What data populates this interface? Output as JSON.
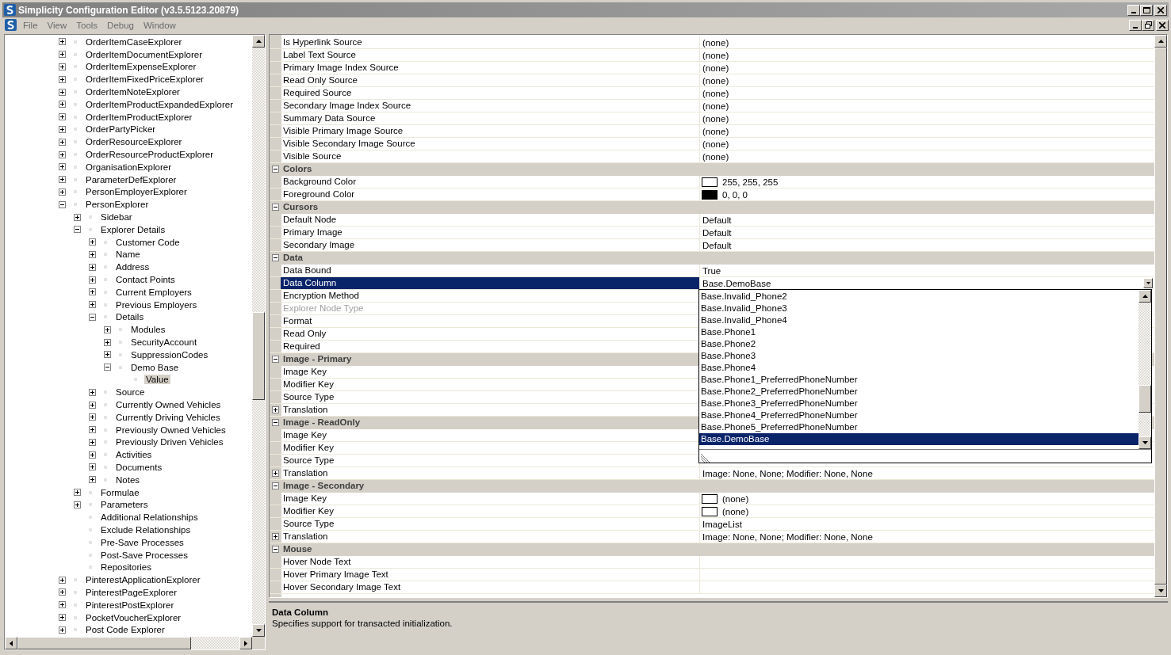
{
  "window": {
    "title": "Simplicity Configuration Editor (v3.5.5123.20879)"
  },
  "menu": [
    {
      "label": "File"
    },
    {
      "label": "View"
    },
    {
      "label": "Tools"
    },
    {
      "label": "Debug"
    },
    {
      "label": "Window"
    }
  ],
  "tree": {
    "nodes": [
      {
        "label": "OrderItemCaseExplorer",
        "kind": "folder",
        "expanded": false,
        "selected": false
      },
      {
        "label": "OrderItemDocumentExplorer",
        "kind": "folder",
        "expanded": false,
        "selected": false
      },
      {
        "label": "OrderItemExpenseExplorer",
        "kind": "folder",
        "expanded": false,
        "selected": false
      },
      {
        "label": "OrderItemFixedPriceExplorer",
        "kind": "folder",
        "expanded": false,
        "selected": false
      },
      {
        "label": "OrderItemNoteExplorer",
        "kind": "folder",
        "expanded": false,
        "selected": false
      },
      {
        "label": "OrderItemProductExpandedExplorer",
        "kind": "folder",
        "expanded": false,
        "selected": false
      },
      {
        "label": "OrderItemProductExplorer",
        "kind": "folder",
        "expanded": false,
        "selected": false
      },
      {
        "label": "OrderPartyPicker",
        "kind": "folder",
        "expanded": false,
        "selected": false
      },
      {
        "label": "OrderResourceExplorer",
        "kind": "folder",
        "expanded": false,
        "selected": false
      },
      {
        "label": "OrderResourceProductExplorer",
        "kind": "folder",
        "expanded": false,
        "selected": false
      },
      {
        "label": "OrganisationExplorer",
        "kind": "folder",
        "expanded": false,
        "selected": false
      },
      {
        "label": "ParameterDefExplorer",
        "kind": "folder",
        "expanded": false,
        "selected": false
      },
      {
        "label": "PersonEmployerExplorer",
        "kind": "folder",
        "expanded": false,
        "selected": false
      },
      {
        "label": "PersonExplorer",
        "kind": "folder",
        "expanded": true,
        "selected": false,
        "children": [
          {
            "label": "Sidebar",
            "kind": "folder",
            "expanded": false,
            "selected": false
          },
          {
            "label": "Explorer Details",
            "kind": "folder",
            "expanded": true,
            "selected": false,
            "children": [
              {
                "label": "Customer Code",
                "kind": "folder",
                "expanded": false,
                "selected": false
              },
              {
                "label": "Name",
                "kind": "folder",
                "expanded": false,
                "selected": false
              },
              {
                "label": "Address",
                "kind": "folder",
                "expanded": false,
                "selected": false
              },
              {
                "label": "Contact Points",
                "kind": "folder",
                "expanded": false,
                "selected": false
              },
              {
                "label": "Current Employers",
                "kind": "folder",
                "expanded": false,
                "selected": false
              },
              {
                "label": "Previous Employers",
                "kind": "folder",
                "expanded": false,
                "selected": false
              },
              {
                "label": "Details",
                "kind": "folder",
                "expanded": true,
                "selected": false,
                "children": [
                  {
                    "label": "Modules",
                    "kind": "folder",
                    "expanded": false,
                    "selected": false
                  },
                  {
                    "label": "SecurityAccount",
                    "kind": "folder",
                    "expanded": false,
                    "selected": false
                  },
                  {
                    "label": "SuppressionCodes",
                    "kind": "folder",
                    "expanded": false,
                    "selected": false
                  },
                  {
                    "label": "Demo Base",
                    "kind": "folder",
                    "expanded": true,
                    "selected": false,
                    "children": [
                      {
                        "label": "Value",
                        "kind": "leaf",
                        "selected": true
                      }
                    ]
                  }
                ]
              },
              {
                "label": "Source",
                "kind": "folder",
                "expanded": false,
                "selected": false
              },
              {
                "label": "Currently Owned Vehicles",
                "kind": "folder",
                "expanded": false,
                "selected": false
              },
              {
                "label": "Currently Driving Vehicles",
                "kind": "folder",
                "expanded": false,
                "selected": false
              },
              {
                "label": "Previously Owned Vehicles",
                "kind": "folder",
                "expanded": false,
                "selected": false
              },
              {
                "label": "Previously Driven Vehicles",
                "kind": "folder",
                "expanded": false,
                "selected": false
              },
              {
                "label": "Activities",
                "kind": "folder",
                "expanded": false,
                "selected": false
              },
              {
                "label": "Documents",
                "kind": "folder",
                "expanded": false,
                "selected": false
              },
              {
                "label": "Notes",
                "kind": "folder",
                "expanded": false,
                "selected": false
              }
            ]
          },
          {
            "label": "Formulae",
            "kind": "folder",
            "expanded": false,
            "selected": false
          },
          {
            "label": "Parameters",
            "kind": "folder",
            "expanded": false,
            "selected": false
          },
          {
            "label": "Additional Relationships",
            "kind": "leaf",
            "selected": false
          },
          {
            "label": "Exclude Relationships",
            "kind": "leaf",
            "selected": false
          },
          {
            "label": "Pre-Save Processes",
            "kind": "leaf",
            "selected": false
          },
          {
            "label": "Post-Save Processes",
            "kind": "leaf",
            "selected": false
          },
          {
            "label": "Repositories",
            "kind": "leaf",
            "selected": false
          }
        ]
      },
      {
        "label": "PinterestApplicationExplorer",
        "kind": "folder",
        "expanded": false,
        "selected": false
      },
      {
        "label": "PinterestPageExplorer",
        "kind": "folder",
        "expanded": false,
        "selected": false
      },
      {
        "label": "PinterestPostExplorer",
        "kind": "folder",
        "expanded": false,
        "selected": false
      },
      {
        "label": "PocketVoucherExplorer",
        "kind": "folder",
        "expanded": false,
        "selected": false
      },
      {
        "label": "Post Code Explorer",
        "kind": "folder",
        "expanded": false,
        "selected": false
      }
    ]
  },
  "property_grid": {
    "rows": [
      {
        "kind": "property",
        "name": "Is Hyperlink Source",
        "value": "(none)",
        "selected": false,
        "disabled": false
      },
      {
        "kind": "property",
        "name": "Label Text Source",
        "value": "(none)",
        "selected": false,
        "disabled": false
      },
      {
        "kind": "property",
        "name": "Primary Image Index Source",
        "value": "(none)",
        "selected": false,
        "disabled": false
      },
      {
        "kind": "property",
        "name": "Read Only Source",
        "value": "(none)",
        "selected": false,
        "disabled": false
      },
      {
        "kind": "property",
        "name": "Required Source",
        "value": "(none)",
        "selected": false,
        "disabled": false
      },
      {
        "kind": "property",
        "name": "Secondary Image Index Source",
        "value": "(none)",
        "selected": false,
        "disabled": false
      },
      {
        "kind": "property",
        "name": "Summary Data Source",
        "value": "(none)",
        "selected": false,
        "disabled": false
      },
      {
        "kind": "property",
        "name": "Visible Primary Image Source",
        "value": "(none)",
        "selected": false,
        "disabled": false
      },
      {
        "kind": "property",
        "name": "Visible Secondary Image Source",
        "value": "(none)",
        "selected": false,
        "disabled": false
      },
      {
        "kind": "property",
        "name": "Visible Source",
        "value": "(none)",
        "selected": false,
        "disabled": false
      },
      {
        "kind": "category",
        "name": "Colors",
        "expanded": true
      },
      {
        "kind": "property",
        "name": "Background Color",
        "value": "255, 255, 255",
        "color": "#ffffff",
        "selected": false,
        "disabled": false
      },
      {
        "kind": "property",
        "name": "Foreground Color",
        "value": "0, 0, 0",
        "color": "#000000",
        "selected": false,
        "disabled": false
      },
      {
        "kind": "category",
        "name": "Cursors",
        "expanded": true
      },
      {
        "kind": "property",
        "name": "Default Node",
        "value": "Default",
        "selected": false,
        "disabled": false
      },
      {
        "kind": "property",
        "name": "Primary Image",
        "value": "Default",
        "selected": false,
        "disabled": false
      },
      {
        "kind": "property",
        "name": "Secondary Image",
        "value": "Default",
        "selected": false,
        "disabled": false
      },
      {
        "kind": "category",
        "name": "Data",
        "expanded": true
      },
      {
        "kind": "property",
        "name": "Data Bound",
        "value": "True",
        "selected": false,
        "disabled": false
      },
      {
        "kind": "property",
        "name": "Data Column",
        "value": "Base.DemoBase",
        "selected": true,
        "disabled": false,
        "dropdown": {
          "items": [
            {
              "label": "Base.Invalid_Phone2",
              "selected": false
            },
            {
              "label": "Base.Invalid_Phone3",
              "selected": false
            },
            {
              "label": "Base.Invalid_Phone4",
              "selected": false
            },
            {
              "label": "Base.Phone1",
              "selected": false
            },
            {
              "label": "Base.Phone2",
              "selected": false
            },
            {
              "label": "Base.Phone3",
              "selected": false
            },
            {
              "label": "Base.Phone4",
              "selected": false
            },
            {
              "label": "Base.Phone1_PreferredPhoneNumber",
              "selected": false
            },
            {
              "label": "Base.Phone2_PreferredPhoneNumber",
              "selected": false
            },
            {
              "label": "Base.Phone3_PreferredPhoneNumber",
              "selected": false
            },
            {
              "label": "Base.Phone4_PreferredPhoneNumber",
              "selected": false
            },
            {
              "label": "Base.Phone5_PreferredPhoneNumber",
              "selected": false
            },
            {
              "label": "Base.DemoBase",
              "selected": true
            }
          ]
        }
      },
      {
        "kind": "property",
        "name": "Encryption Method",
        "selected": false,
        "disabled": false
      },
      {
        "kind": "property",
        "name": "Explorer Node Type",
        "selected": false,
        "disabled": true
      },
      {
        "kind": "property",
        "name": "Format",
        "selected": false,
        "disabled": false
      },
      {
        "kind": "property",
        "name": "Read Only",
        "selected": false,
        "disabled": false
      },
      {
        "kind": "property",
        "name": "Required",
        "selected": false,
        "disabled": false
      },
      {
        "kind": "category",
        "name": "Image - Primary",
        "expanded": true
      },
      {
        "kind": "property",
        "name": "Image Key",
        "selected": false,
        "disabled": false
      },
      {
        "kind": "property",
        "name": "Modifier Key",
        "selected": false,
        "disabled": false
      },
      {
        "kind": "property",
        "name": "Source Type",
        "selected": false,
        "disabled": false
      },
      {
        "kind": "property",
        "name": "Translation",
        "expanded": false,
        "selected": false,
        "disabled": false
      },
      {
        "kind": "category",
        "name": "Image - ReadOnly",
        "expanded": true
      },
      {
        "kind": "property",
        "name": "Image Key",
        "selected": false,
        "disabled": false
      },
      {
        "kind": "property",
        "name": "Modifier Key",
        "selected": false,
        "disabled": false
      },
      {
        "kind": "property",
        "name": "Source Type",
        "selected": false,
        "disabled": false
      },
      {
        "kind": "property",
        "name": "Translation",
        "value": "Image: None, None; Modifier: None, None",
        "expanded": false,
        "selected": false,
        "disabled": false
      },
      {
        "kind": "category",
        "name": "Image - Secondary",
        "expanded": true
      },
      {
        "kind": "property",
        "name": "Image Key",
        "value": "(none)",
        "preview": true,
        "selected": false,
        "disabled": false
      },
      {
        "kind": "property",
        "name": "Modifier Key",
        "value": "(none)",
        "preview": true,
        "selected": false,
        "disabled": false
      },
      {
        "kind": "property",
        "name": "Source Type",
        "value": "ImageList",
        "selected": false,
        "disabled": false
      },
      {
        "kind": "property",
        "name": "Translation",
        "value": "Image: None, None; Modifier: None, None",
        "expanded": false,
        "selected": false,
        "disabled": false
      },
      {
        "kind": "category",
        "name": "Mouse",
        "expanded": true
      },
      {
        "kind": "property",
        "name": "Hover Node Text",
        "selected": false,
        "disabled": false
      },
      {
        "kind": "property",
        "name": "Hover Primary Image Text",
        "selected": false,
        "disabled": false
      },
      {
        "kind": "property",
        "name": "Hover Secondary Image Text",
        "selected": false,
        "disabled": false
      }
    ]
  },
  "description": {
    "title": "Data Column",
    "text": "Specifies support for transacted initialization."
  }
}
